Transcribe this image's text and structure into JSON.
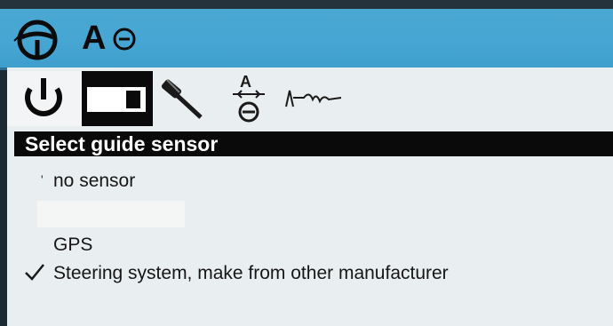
{
  "titlebar": {
    "title": "A",
    "icons": [
      "steering-wheel-icon",
      "speedometer-icon"
    ]
  },
  "tabs": [
    {
      "icon": "power-icon",
      "active": false
    },
    {
      "icon": "window-icon",
      "active": true
    },
    {
      "icon": "screwdriver-icon",
      "active": false
    },
    {
      "icon": "calibration-icon",
      "active": false,
      "label": "A"
    },
    {
      "icon": "signal-icon",
      "active": false
    }
  ],
  "section": {
    "title": "Select guide sensor"
  },
  "options": [
    {
      "label": "no sensor",
      "selected": false
    },
    {
      "label": "",
      "selected": false,
      "redacted": true
    },
    {
      "label": "GPS",
      "selected": false
    },
    {
      "label": "Steering system, make from other manufacturer",
      "selected": true
    }
  ],
  "colors": {
    "titlebar": "#47a6d3",
    "header": "#0a0a0a",
    "content": "#e9eef0"
  }
}
